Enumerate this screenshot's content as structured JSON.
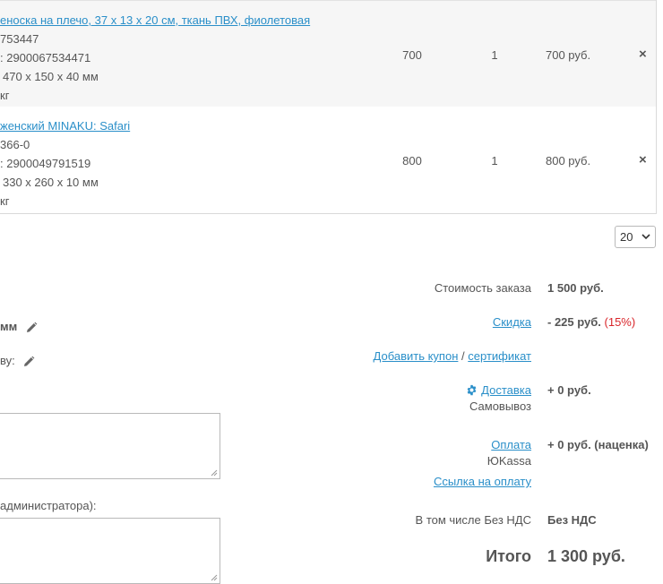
{
  "items": [
    {
      "name": "еноска на плечо, 37 х 13 х 20 см, ткань ПВХ, фиолетовая",
      "article": "753447",
      "barcode": ": 2900067534471",
      "dimensions": "470 х 150 х 40 мм",
      "weight": "кг",
      "price": "700",
      "qty": "1",
      "total": "700 руб."
    },
    {
      "name": "женский MINAKU: Safari",
      "article": "366-0",
      "barcode": ": 2900049791519",
      "dimensions": "330 х 260 х 10 мм",
      "weight": "кг",
      "price": "800",
      "qty": "1",
      "total": "800 руб."
    }
  ],
  "delete_symbol": "×",
  "per_page": {
    "value": "20"
  },
  "left": {
    "field1_label": "мм",
    "field2_label": "ву:",
    "comment_label": "администратора):"
  },
  "summary": {
    "order_cost_label": "Стоимость заказа",
    "order_cost_value": "1 500 руб.",
    "discount_label": "Скидка",
    "discount_value": "- 225 руб.",
    "discount_percent": "(15%)",
    "add_coupon_label": "Добавить купон",
    "slash": "/",
    "certificate_label": "сертификат",
    "delivery_label": "Доставка",
    "delivery_value": "+ 0 руб.",
    "delivery_method": "Самовывоз",
    "payment_label": "Оплата",
    "payment_value": "+ 0 руб. (наценка)",
    "payment_method": "ЮKassa",
    "payment_link_label": "Ссылка на оплату",
    "vat_label": "В том числе Без НДС",
    "vat_value": "Без НДС",
    "total_label": "Итого",
    "total_value": "1 300 руб."
  },
  "colors": {
    "link": "#2a8fc9",
    "percent": "#d9252a",
    "text": "#555555",
    "row_alt": "#f6f6f6"
  },
  "icons": {
    "edit": "pencil-icon",
    "delete": "close-icon",
    "delivery": "gear-icon",
    "select": "chevron-down-icon"
  }
}
